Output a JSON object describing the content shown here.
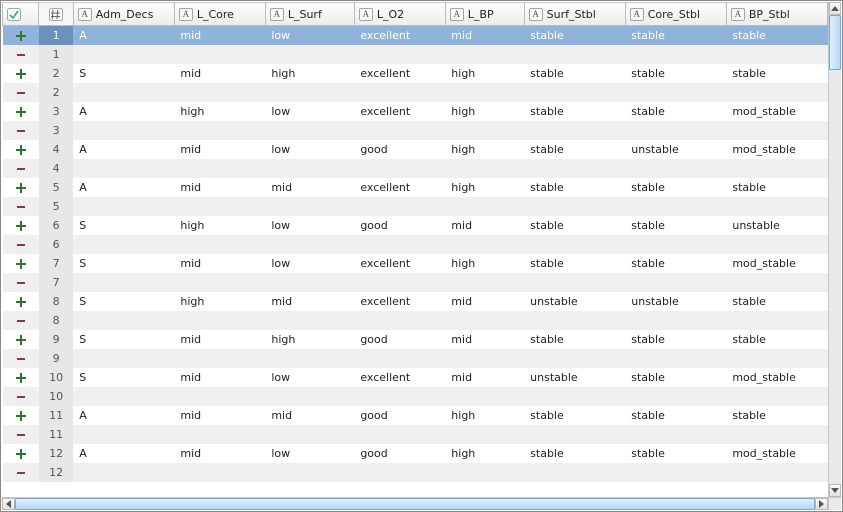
{
  "columns": [
    {
      "key": "Adm_Decs",
      "label": "Adm_Decs"
    },
    {
      "key": "L_Core",
      "label": "L_Core"
    },
    {
      "key": "L_Surf",
      "label": "L_Surf"
    },
    {
      "key": "L_O2",
      "label": "L_O2"
    },
    {
      "key": "L_BP",
      "label": "L_BP"
    },
    {
      "key": "Surf_Stbl",
      "label": "Surf_Stbl"
    },
    {
      "key": "Core_Stbl",
      "label": "Core_Stbl"
    },
    {
      "key": "BP_Stbl",
      "label": "BP_Stbl"
    }
  ],
  "icon_letter": "A",
  "selected_row": 0,
  "rows": [
    {
      "mark": "plus",
      "idx": "1",
      "Adm_Decs": "A",
      "L_Core": "mid",
      "L_Surf": "low",
      "L_O2": "excellent",
      "L_BP": "mid",
      "Surf_Stbl": "stable",
      "Core_Stbl": "stable",
      "BP_Stbl": "stable"
    },
    {
      "mark": "minus",
      "idx": "1",
      "Adm_Decs": "",
      "L_Core": "",
      "L_Surf": "",
      "L_O2": "",
      "L_BP": "",
      "Surf_Stbl": "",
      "Core_Stbl": "",
      "BP_Stbl": ""
    },
    {
      "mark": "plus",
      "idx": "2",
      "Adm_Decs": "S",
      "L_Core": "mid",
      "L_Surf": "high",
      "L_O2": "excellent",
      "L_BP": "high",
      "Surf_Stbl": "stable",
      "Core_Stbl": "stable",
      "BP_Stbl": "stable"
    },
    {
      "mark": "minus",
      "idx": "2",
      "Adm_Decs": "",
      "L_Core": "",
      "L_Surf": "",
      "L_O2": "",
      "L_BP": "",
      "Surf_Stbl": "",
      "Core_Stbl": "",
      "BP_Stbl": ""
    },
    {
      "mark": "plus",
      "idx": "3",
      "Adm_Decs": "A",
      "L_Core": "high",
      "L_Surf": "low",
      "L_O2": "excellent",
      "L_BP": "high",
      "Surf_Stbl": "stable",
      "Core_Stbl": "stable",
      "BP_Stbl": "mod_stable"
    },
    {
      "mark": "minus",
      "idx": "3",
      "Adm_Decs": "",
      "L_Core": "",
      "L_Surf": "",
      "L_O2": "",
      "L_BP": "",
      "Surf_Stbl": "",
      "Core_Stbl": "",
      "BP_Stbl": ""
    },
    {
      "mark": "plus",
      "idx": "4",
      "Adm_Decs": "A",
      "L_Core": "mid",
      "L_Surf": "low",
      "L_O2": "good",
      "L_BP": "high",
      "Surf_Stbl": "stable",
      "Core_Stbl": "unstable",
      "BP_Stbl": "mod_stable"
    },
    {
      "mark": "minus",
      "idx": "4",
      "Adm_Decs": "",
      "L_Core": "",
      "L_Surf": "",
      "L_O2": "",
      "L_BP": "",
      "Surf_Stbl": "",
      "Core_Stbl": "",
      "BP_Stbl": ""
    },
    {
      "mark": "plus",
      "idx": "5",
      "Adm_Decs": "A",
      "L_Core": "mid",
      "L_Surf": "mid",
      "L_O2": "excellent",
      "L_BP": "high",
      "Surf_Stbl": "stable",
      "Core_Stbl": "stable",
      "BP_Stbl": "stable"
    },
    {
      "mark": "minus",
      "idx": "5",
      "Adm_Decs": "",
      "L_Core": "",
      "L_Surf": "",
      "L_O2": "",
      "L_BP": "",
      "Surf_Stbl": "",
      "Core_Stbl": "",
      "BP_Stbl": ""
    },
    {
      "mark": "plus",
      "idx": "6",
      "Adm_Decs": "S",
      "L_Core": "high",
      "L_Surf": "low",
      "L_O2": "good",
      "L_BP": "mid",
      "Surf_Stbl": "stable",
      "Core_Stbl": "stable",
      "BP_Stbl": "unstable"
    },
    {
      "mark": "minus",
      "idx": "6",
      "Adm_Decs": "",
      "L_Core": "",
      "L_Surf": "",
      "L_O2": "",
      "L_BP": "",
      "Surf_Stbl": "",
      "Core_Stbl": "",
      "BP_Stbl": ""
    },
    {
      "mark": "plus",
      "idx": "7",
      "Adm_Decs": "S",
      "L_Core": "mid",
      "L_Surf": "low",
      "L_O2": "excellent",
      "L_BP": "high",
      "Surf_Stbl": "stable",
      "Core_Stbl": "stable",
      "BP_Stbl": "mod_stable"
    },
    {
      "mark": "minus",
      "idx": "7",
      "Adm_Decs": "",
      "L_Core": "",
      "L_Surf": "",
      "L_O2": "",
      "L_BP": "",
      "Surf_Stbl": "",
      "Core_Stbl": "",
      "BP_Stbl": ""
    },
    {
      "mark": "plus",
      "idx": "8",
      "Adm_Decs": "S",
      "L_Core": "high",
      "L_Surf": "mid",
      "L_O2": "excellent",
      "L_BP": "mid",
      "Surf_Stbl": "unstable",
      "Core_Stbl": "unstable",
      "BP_Stbl": "stable"
    },
    {
      "mark": "minus",
      "idx": "8",
      "Adm_Decs": "",
      "L_Core": "",
      "L_Surf": "",
      "L_O2": "",
      "L_BP": "",
      "Surf_Stbl": "",
      "Core_Stbl": "",
      "BP_Stbl": ""
    },
    {
      "mark": "plus",
      "idx": "9",
      "Adm_Decs": "S",
      "L_Core": "mid",
      "L_Surf": "high",
      "L_O2": "good",
      "L_BP": "mid",
      "Surf_Stbl": "stable",
      "Core_Stbl": "stable",
      "BP_Stbl": "stable"
    },
    {
      "mark": "minus",
      "idx": "9",
      "Adm_Decs": "",
      "L_Core": "",
      "L_Surf": "",
      "L_O2": "",
      "L_BP": "",
      "Surf_Stbl": "",
      "Core_Stbl": "",
      "BP_Stbl": ""
    },
    {
      "mark": "plus",
      "idx": "10",
      "Adm_Decs": "S",
      "L_Core": "mid",
      "L_Surf": "low",
      "L_O2": "excellent",
      "L_BP": "mid",
      "Surf_Stbl": "unstable",
      "Core_Stbl": "stable",
      "BP_Stbl": "mod_stable"
    },
    {
      "mark": "minus",
      "idx": "10",
      "Adm_Decs": "",
      "L_Core": "",
      "L_Surf": "",
      "L_O2": "",
      "L_BP": "",
      "Surf_Stbl": "",
      "Core_Stbl": "",
      "BP_Stbl": ""
    },
    {
      "mark": "plus",
      "idx": "11",
      "Adm_Decs": "A",
      "L_Core": "mid",
      "L_Surf": "mid",
      "L_O2": "good",
      "L_BP": "high",
      "Surf_Stbl": "stable",
      "Core_Stbl": "stable",
      "BP_Stbl": "stable"
    },
    {
      "mark": "minus",
      "idx": "11",
      "Adm_Decs": "",
      "L_Core": "",
      "L_Surf": "",
      "L_O2": "",
      "L_BP": "",
      "Surf_Stbl": "",
      "Core_Stbl": "",
      "BP_Stbl": ""
    },
    {
      "mark": "plus",
      "idx": "12",
      "Adm_Decs": "A",
      "L_Core": "mid",
      "L_Surf": "low",
      "L_O2": "good",
      "L_BP": "high",
      "Surf_Stbl": "stable",
      "Core_Stbl": "stable",
      "BP_Stbl": "mod_stable"
    },
    {
      "mark": "minus",
      "idx": "12",
      "Adm_Decs": "",
      "L_Core": "",
      "L_Surf": "",
      "L_O2": "",
      "L_BP": "",
      "Surf_Stbl": "",
      "Core_Stbl": "",
      "BP_Stbl": ""
    }
  ]
}
